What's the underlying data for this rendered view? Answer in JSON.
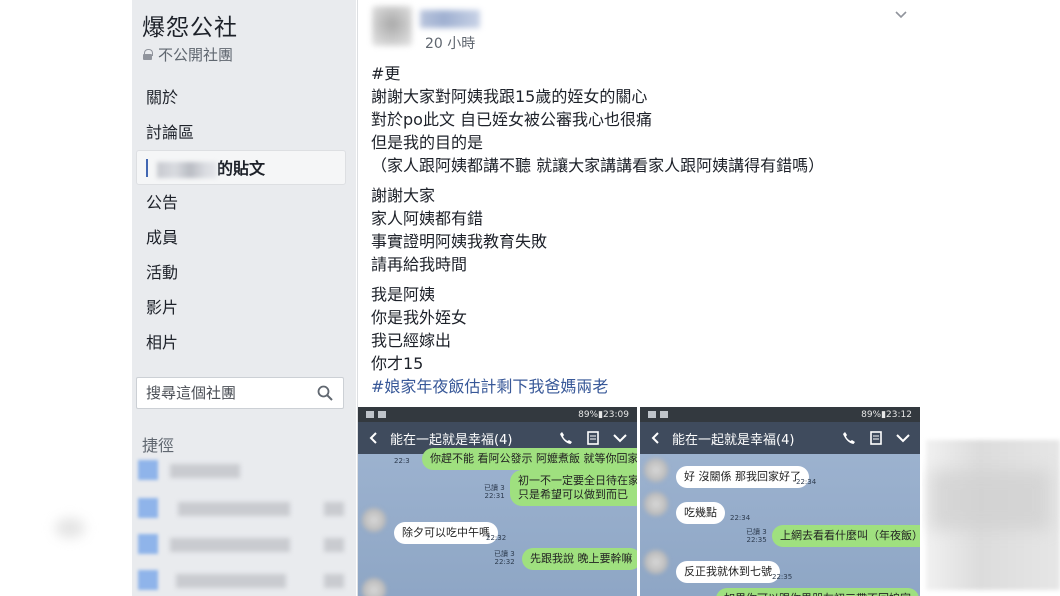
{
  "group": {
    "title": "爆怨公社",
    "privacy": "不公開社團"
  },
  "nav": {
    "items": [
      "關於",
      "討論區",
      "的貼文",
      "公告",
      "成員",
      "活動",
      "影片",
      "相片"
    ]
  },
  "search": {
    "placeholder": "搜尋這個社團"
  },
  "shortcuts": {
    "label": "捷徑"
  },
  "post": {
    "time": "20 小時",
    "paragraphs": [
      [
        "#更",
        "謝謝大家對阿姨我跟15歲的姪女的關心",
        "對於po此文 自已姪女被公審我心也很痛",
        "但是我的目的是",
        "（家人跟阿姨都講不聽 就讓大家講講看家人跟阿姨講得有錯嗎）"
      ],
      [
        "謝謝大家",
        "家人阿姨都有錯",
        "事實證明阿姨我教育失敗",
        "請再給我時間"
      ],
      [
        "我是阿姨",
        "你是我外姪女",
        "我已經嫁出",
        "你才15"
      ]
    ],
    "hashtag": "#娘家年夜飯估計剩下我爸媽兩老"
  },
  "screenshots": [
    {
      "status_time": "89%▮23:09",
      "chat_title": "能在一起就是幸福(4)",
      "messages": [
        {
          "type": "green",
          "text": "你趕不能 看阿公發示 阿嬤煮飯 就等你回家吧",
          "meta": "22:3"
        },
        {
          "type": "green",
          "text": "初一不一定要全日待在家",
          "text2": "只是希望可以做到而已",
          "meta": "已讀 3\n22:31"
        },
        {
          "type": "white",
          "text": "除夕可以吃中午嗎",
          "meta": "22:32"
        },
        {
          "type": "green",
          "text": "先跟我說  晚上要幹嘛",
          "meta": "已讀 3\n22:32"
        }
      ]
    },
    {
      "status_time": "89%▮23:12",
      "chat_title": "能在一起就是幸福(4)",
      "messages": [
        {
          "type": "white",
          "text": "好 沒關係 那我回家好了",
          "meta": "22:34"
        },
        {
          "type": "white",
          "text": "吃幾點",
          "meta": "22:34"
        },
        {
          "type": "green",
          "text": "上網去看看什麼叫（年夜飯）",
          "meta": "已讀 3\n22:35"
        },
        {
          "type": "white",
          "text": "反正我就休到七號",
          "meta": "22:35"
        },
        {
          "type": "green",
          "text": "如果你可以跟你男朋友初三帶不回娘家",
          "meta": ""
        }
      ]
    }
  ]
}
